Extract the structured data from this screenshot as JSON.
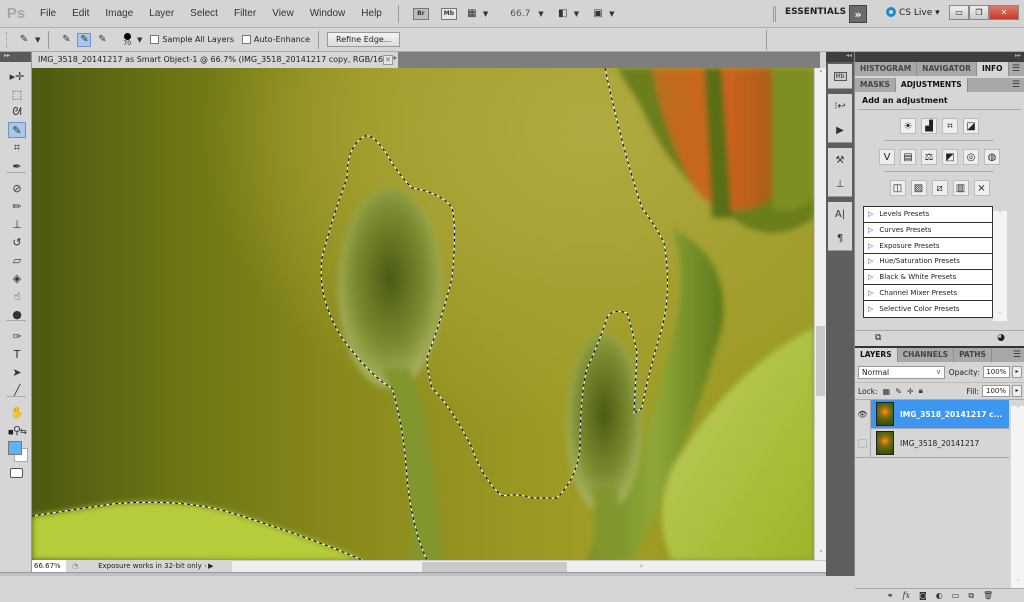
{
  "app": {
    "logo": "Ps",
    "menu": [
      "File",
      "Edit",
      "Image",
      "Layer",
      "Select",
      "Filter",
      "View",
      "Window",
      "Help"
    ],
    "appbar": {
      "bridge_label": "Br",
      "minibridge_label": "Mb",
      "zoom_level": "66.7",
      "workspace": "ESSENTIALS",
      "workspace_more": "»",
      "cs_live": "CS Live ▾"
    },
    "window_controls": {
      "minimize": "▭",
      "restore": "❐",
      "close": "✕"
    }
  },
  "options_bar": {
    "brush_size": "70",
    "sample_all_layers": {
      "label": "Sample All Layers",
      "checked": false
    },
    "auto_enhance": {
      "label": "Auto-Enhance",
      "checked": false
    },
    "refine_edge": "Refine Edge..."
  },
  "toolbox": {
    "tools": [
      {
        "name": "move-tool",
        "glyph": "▸✛"
      },
      {
        "name": "marquee-tool",
        "glyph": "⬚"
      },
      {
        "name": "lasso-tool",
        "glyph": "ᘛ"
      },
      {
        "name": "quick-selection-tool",
        "glyph": "✎",
        "active": true
      },
      {
        "name": "crop-tool",
        "glyph": "⌗"
      },
      {
        "name": "eyedropper-tool",
        "glyph": "✒"
      },
      {
        "name": "spot-healing-tool",
        "glyph": "⊘"
      },
      {
        "name": "brush-tool",
        "glyph": "✏"
      },
      {
        "name": "clone-stamp-tool",
        "glyph": "⊥"
      },
      {
        "name": "history-brush-tool",
        "glyph": "↺"
      },
      {
        "name": "eraser-tool",
        "glyph": "▱"
      },
      {
        "name": "paint-bucket-tool",
        "glyph": "◈"
      },
      {
        "name": "blur-tool",
        "glyph": "☝"
      },
      {
        "name": "dodge-tool",
        "glyph": "●"
      },
      {
        "name": "pen-tool",
        "glyph": "✑"
      },
      {
        "name": "type-tool",
        "glyph": "T"
      },
      {
        "name": "path-selection-tool",
        "glyph": "➤"
      },
      {
        "name": "line-tool",
        "glyph": "╱"
      },
      {
        "name": "hand-tool",
        "glyph": "✋"
      },
      {
        "name": "zoom-tool",
        "glyph": "⚲"
      }
    ],
    "foreground_color": "#5ab4f7",
    "background_color": "#ffffff"
  },
  "document": {
    "tab_title": "IMG_3518_20141217 as Smart Object-1 @ 66.7% (IMG_3518_20141217 copy, RGB/16*) *",
    "close": "✕"
  },
  "status_bar": {
    "zoom": "66.67%",
    "info": "Exposure works in 32-bit only",
    "arrow": "▶"
  },
  "panels": {
    "top_tabs": [
      {
        "label": "HISTOGRAM",
        "active": false
      },
      {
        "label": "NAVIGATOR",
        "active": false
      },
      {
        "label": "INFO",
        "active": true
      }
    ],
    "adj_tabs": [
      {
        "label": "MASKS",
        "active": false
      },
      {
        "label": "ADJUSTMENTS",
        "active": true
      }
    ],
    "add_adjustment": "Add an adjustment",
    "adjustment_rows": [
      [
        "brightness-contrast",
        "levels",
        "curves",
        "exposure"
      ],
      [
        "vibrance",
        "hue-saturation",
        "color-balance",
        "black-white",
        "photo-filter",
        "channel-mixer"
      ],
      [
        "invert",
        "posterize",
        "threshold",
        "gradient-map",
        "selective-color"
      ]
    ],
    "adjustment_glyphs": [
      [
        "☀",
        "▟",
        "⌗",
        "◪"
      ],
      [
        "V",
        "▤",
        "⚖",
        "◩",
        "◎",
        "◍"
      ],
      [
        "◫",
        "▨",
        "⧄",
        "▥",
        "⨯"
      ]
    ],
    "presets": [
      "Levels Presets",
      "Curves Presets",
      "Exposure Presets",
      "Hue/Saturation Presets",
      "Black & White Presets",
      "Channel Mixer Presets",
      "Selective Color Presets"
    ],
    "layer_tabs": [
      {
        "label": "LAYERS",
        "active": true
      },
      {
        "label": "CHANNELS",
        "active": false
      },
      {
        "label": "PATHS",
        "active": false
      }
    ],
    "blend_mode": "Normal",
    "opacity_label": "Opacity:",
    "opacity": "100%",
    "lock_label": "Lock:",
    "fill_label": "Fill:",
    "fill": "100%",
    "layers": [
      {
        "name": "IMG_3518_20141217 c...",
        "visible": true,
        "selected": true
      },
      {
        "name": "IMG_3518_20141217",
        "visible": false,
        "selected": false
      }
    ]
  }
}
